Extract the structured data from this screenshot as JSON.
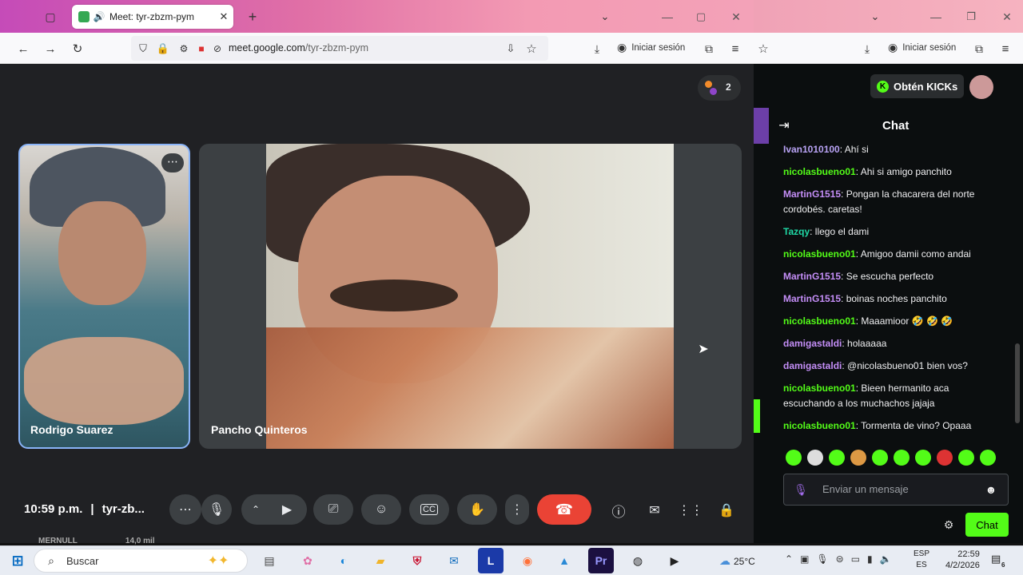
{
  "left_browser": {
    "tab_title": "Meet: tyr-zbzm-pym",
    "url_host": "meet.google.com",
    "url_path": "/tyr-zbzm-pym",
    "signin_label": "Iniciar sesión"
  },
  "meet": {
    "participant_count": "2",
    "tiles": [
      {
        "name": "Rodrigo Suarez"
      },
      {
        "name": "Pancho Quinteros"
      }
    ],
    "time": "10:59 p.m.",
    "separator": "|",
    "meeting_code": "tyr-zb...",
    "bottom_overflow_text": "MERNULL",
    "bottom_overflow_text2": "14,0 mil"
  },
  "right_browser": {
    "signin_label": "Iniciar sesión"
  },
  "kick": {
    "get_kicks_label": "Obtén KICKs",
    "chat_title": "Chat",
    "message_placeholder": "Enviar un mensaje",
    "chat_button_label": "Chat",
    "messages": [
      {
        "user": "Ivan1010100",
        "color": "#b9a3f5",
        "text": ": Ahí si"
      },
      {
        "user": "nicolasbueno01",
        "color": "#53fc18",
        "text": ": Ahi si amigo panchito"
      },
      {
        "user": "MartinG1515",
        "color": "#c48ef7",
        "text": ": Pongan la chacarera del norte cordobés. caretas!"
      },
      {
        "user": "Tazqy",
        "color": "#1fd8a5",
        "text": ": llego el dami"
      },
      {
        "user": "nicolasbueno01",
        "color": "#53fc18",
        "text": ": Amigoo damii como andai"
      },
      {
        "user": "MartinG1515",
        "color": "#c48ef7",
        "text": ": Se escucha perfecto"
      },
      {
        "user": "MartinG1515",
        "color": "#c48ef7",
        "text": ": boinas noches panchito"
      },
      {
        "user": "nicolasbueno01",
        "color": "#53fc18",
        "text": ": Maaamioor 🤣 🤣 🤣"
      },
      {
        "user": "damigastaldi",
        "color": "#c48ef7",
        "text": ": holaaaaa"
      },
      {
        "user": "damigastaldi",
        "color": "#c48ef7",
        "text": ": @nicolasbueno01 bien vos?"
      },
      {
        "user": "nicolasbueno01",
        "color": "#53fc18",
        "text": ": Bieen hermanito aca escuchando a los muchachos jajaja"
      },
      {
        "user": "nicolasbueno01",
        "color": "#53fc18",
        "text": ": Tormenta de vino? Opaaa"
      }
    ]
  },
  "taskbar": {
    "search_placeholder": "Buscar",
    "weather": "25°C",
    "lang_top": "ESP",
    "lang_bottom": "ES",
    "clock_time": "22:59",
    "clock_date": "4/2/2026",
    "notification_count": "6"
  },
  "colors": {
    "meet_bg": "#202124",
    "end_call_red": "#ea4335",
    "kick_green": "#53fc18"
  }
}
